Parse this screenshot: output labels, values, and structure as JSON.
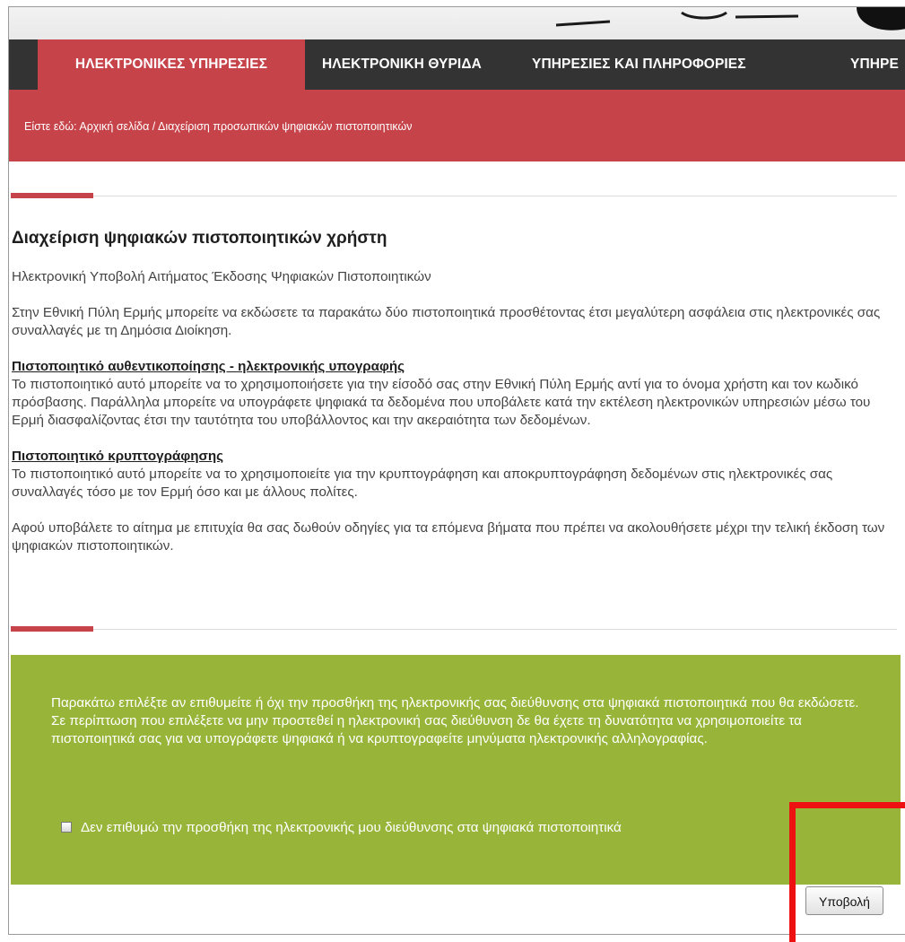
{
  "nav": {
    "items": [
      {
        "label": "ΗΛΕΚΤΡΟΝΙΚΕΣ ΥΠΗΡΕΣΙΕΣ",
        "active": true
      },
      {
        "label": "ΗΛΕΚΤΡΟΝΙΚΗ ΘΥΡΙΔΑ",
        "active": false
      },
      {
        "label": "ΥΠΗΡΕΣΙΕΣ ΚΑΙ ΠΛΗΡΟΦΟΡΙΕΣ",
        "active": false
      },
      {
        "label": "ΥΠΗΡΕ",
        "active": false
      }
    ]
  },
  "breadcrumb": {
    "text": "Είστε εδώ: Αρχική σελίδα / Διαχείριση προσωπικών ψηφιακών πιστοποιητικών"
  },
  "main": {
    "title": "Διαχείριση ψηφιακών πιστοποιητικών χρήστη",
    "subtitle": "Ηλεκτρονική Υποβολή Αιτήματος Έκδοσης Ψηφιακών Πιστοποιητικών",
    "intro": "Στην Εθνική Πύλη Ερμής μπορείτε να εκδώσετε τα παρακάτω δύο πιστοποιητικά προσθέτοντας έτσι μεγαλύτερη ασφάλεια στις ηλεκτρονικές σας συναλλαγές με τη Δημόσια Διοίκηση.",
    "auth_heading": "Πιστοποιητικό αυθεντικοποίησης - ηλεκτρονικής υπογραφής",
    "auth_text": "Το πιστοποιητικό αυτό μπορείτε να το χρησιμοποιήσετε για την είσοδό σας στην Εθνική Πύλη Ερμής αντί για το όνομα χρήστη και τον κωδικό πρόσβασης. Παράλληλα μπορείτε να υπογράφετε ψηφιακά τα δεδομένα που υποβάλετε κατά την εκτέλεση ηλεκτρονικών υπηρεσιών μέσω του Ερμή διασφαλίζοντας έτσι την ταυτότητα του υποβάλλοντος και την ακεραιότητα των δεδομένων.",
    "enc_heading": "Πιστοποιητικό κρυπτογράφησης",
    "enc_text": "Το πιστοποιητικό αυτό μπορείτε να το χρησιμοποιείτε για την κρυπτογράφηση και αποκρυπτογράφηση δεδομένων στις ηλεκτρονικές σας συναλλαγές τόσο με τον Ερμή όσο και με άλλους πολίτες.",
    "outro": "Αφού υποβάλετε το αίτημα με επιτυχία θα σας δωθούν οδηγίες για τα επόμενα βήματα που πρέπει να ακολουθήσετε μέχρι την τελική έκδοση των ψηφιακών πιστοποιητικών."
  },
  "green_box": {
    "text": "Παρακάτω επιλέξτε αν επιθυμείτε ή όχι την προσθήκη της ηλεκτρονικής σας διεύθυνσης στα ψηφιακά πιστοποιητικά που θα εκδώσετε. Σε περίπτωση που επιλέξετε να μην προστεθεί η ηλεκτρονική σας διεύθυνση δε θα έχετε τη δυνατότητα να χρησιμοποιείτε τα πιστοποιητικά σας για να υπογράφετε ψηφιακά ή να κρυπτογραφείτε μηνύματα ηλεκτρονικής αλληλογραφίας.",
    "checkbox_label": "Δεν επιθυμώ την προσθήκη της ηλεκτρονικής μου διεύθυνσης στα ψηφιακά πιστοποιητικά",
    "checkbox_checked": false
  },
  "submit": {
    "label": "Υποβολή"
  },
  "colors": {
    "nav_bg": "#333333",
    "accent_red": "#c7434a",
    "green_panel": "#98b53a",
    "highlight_red": "#ee1111"
  }
}
